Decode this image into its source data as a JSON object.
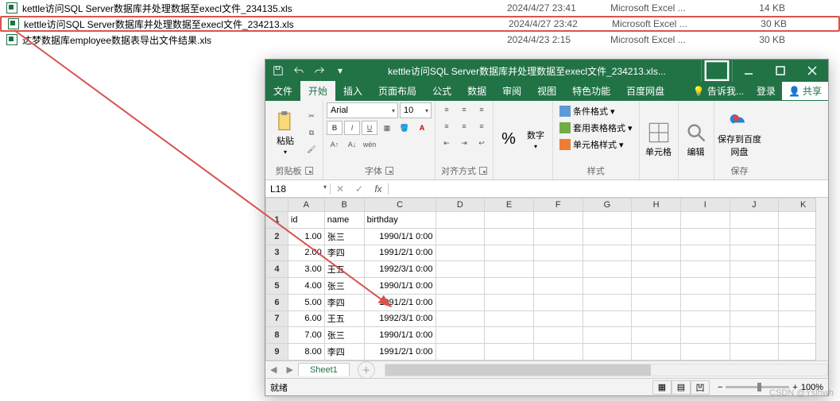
{
  "explorer": {
    "rows": [
      {
        "name": "kettle访问SQL Server数据库并处理数据至execl文件_234135.xls",
        "date": "2024/4/27 23:41",
        "type": "Microsoft Excel ...",
        "size": "14 KB",
        "hl": false
      },
      {
        "name": "kettle访问SQL Server数据库并处理数据至execl文件_234213.xls",
        "date": "2024/4/27 23:42",
        "type": "Microsoft Excel ...",
        "size": "30 KB",
        "hl": true
      },
      {
        "name": "达梦数据库employee数据表导出文件结果.xls",
        "date": "2024/4/23 2:15",
        "type": "Microsoft Excel ...",
        "size": "30 KB",
        "hl": false
      }
    ]
  },
  "excel": {
    "title": "kettle访问SQL Server数据库并处理数据至execl文件_234213.xls...",
    "tabs": {
      "file": "文件",
      "home": "开始",
      "insert": "插入",
      "layout": "页面布局",
      "formula": "公式",
      "data": "数据",
      "review": "审阅",
      "view": "视图",
      "special": "特色功能",
      "baidu": "百度网盘",
      "tell": "告诉我...",
      "login": "登录",
      "share": "共享"
    },
    "ribbon": {
      "paste": "粘贴",
      "clipboard": "剪贴板",
      "font_name": "Arial",
      "font_size": "10",
      "font_group": "字体",
      "align_group": "对齐方式",
      "number": "数字",
      "pct": "%",
      "cond_fmt": "条件格式",
      "table_fmt": "套用表格格式",
      "cell_fmt": "单元格样式",
      "styles": "样式",
      "cells": "单元格",
      "edit": "编辑",
      "baidu_save": "保存到百度网盘",
      "baidu_group": "保存"
    },
    "formula_bar": {
      "namebox": "L18",
      "fx": "fx",
      "value": ""
    },
    "columns": [
      "A",
      "B",
      "C",
      "D",
      "E",
      "F",
      "G",
      "H",
      "I",
      "J",
      "K"
    ],
    "headers": {
      "id": "id",
      "name": "name",
      "birthday": "birthday"
    },
    "rows": [
      {
        "n": "1"
      },
      {
        "n": "2",
        "id": "1.00",
        "name": "张三",
        "birthday": "1990/1/1 0:00"
      },
      {
        "n": "3",
        "id": "2.00",
        "name": "李四",
        "birthday": "1991/2/1 0:00"
      },
      {
        "n": "4",
        "id": "3.00",
        "name": "王五",
        "birthday": "1992/3/1 0:00"
      },
      {
        "n": "5",
        "id": "4.00",
        "name": "张三",
        "birthday": "1990/1/1 0:00"
      },
      {
        "n": "6",
        "id": "5.00",
        "name": "李四",
        "birthday": "1991/2/1 0:00"
      },
      {
        "n": "7",
        "id": "6.00",
        "name": "王五",
        "birthday": "1992/3/1 0:00"
      },
      {
        "n": "8",
        "id": "7.00",
        "name": "张三",
        "birthday": "1990/1/1 0:00"
      },
      {
        "n": "9",
        "id": "8.00",
        "name": "李四",
        "birthday": "1991/2/1 0:00"
      }
    ],
    "sheet": "Sheet1",
    "status": "就绪",
    "zoom": "100%"
  },
  "watermark": "CSDN @Yslhwh"
}
